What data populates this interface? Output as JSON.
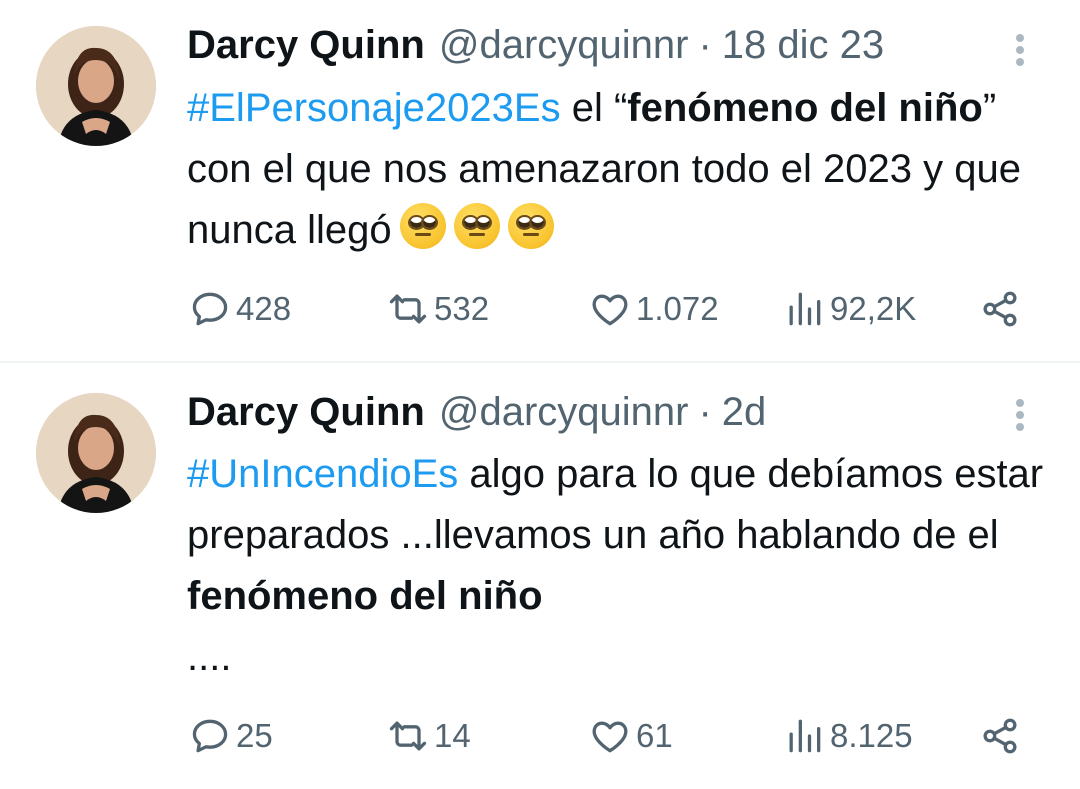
{
  "tweets": [
    {
      "author": "Darcy Quinn",
      "handle": "@darcyquinnr",
      "separator": "·",
      "time": "18 dic 23",
      "hashtag": "#ElPersonaje2023Es",
      "text_parts": [
        " el “",
        "fenómeno del niño",
        "” con el que nos amenazaron todo el 2023 y que nunca llegó"
      ],
      "emojis": [
        "face-with-rolling-eyes",
        "face-with-rolling-eyes",
        "face-with-rolling-eyes"
      ],
      "stats": {
        "replies": "428",
        "retweets": "532",
        "likes": "1.072",
        "views": "92,2K"
      }
    },
    {
      "author": "Darcy Quinn",
      "handle": "@darcyquinnr",
      "separator": "·",
      "time": "2d",
      "hashtag": "#UnIncendioEs",
      "text_parts": [
        " algo para lo que debíamos estar preparados ...llevamos un año hablando de el ",
        "fenómeno del niño",
        ""
      ],
      "trailing": "....",
      "stats": {
        "replies": "25",
        "retweets": "14",
        "likes": "61",
        "views": "8.125"
      }
    }
  ],
  "icons": {
    "reply": "reply-bubble-icon",
    "retweet": "retweet-icon",
    "like": "heart-icon",
    "views": "views-bar-chart-icon",
    "share": "share-icon",
    "more": "more-vertical-icon"
  },
  "colors": {
    "text": "#0f1419",
    "secondary": "#536471",
    "link": "#1d9bf0",
    "divider": "#eff3f4"
  }
}
